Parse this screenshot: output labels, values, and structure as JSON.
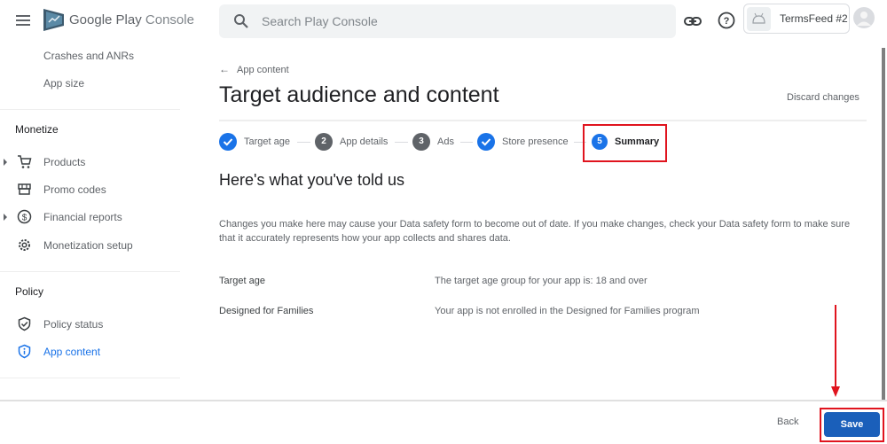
{
  "header": {
    "brand_primary": "Google Play",
    "brand_secondary": "Console",
    "search_placeholder": "Search Play Console",
    "search_value": "",
    "app_name": "TermsFeed #2",
    "icons": [
      "menu-icon",
      "play-console-logo-icon",
      "search-icon",
      "link-icon",
      "help-icon",
      "android-icon",
      "avatar-icon"
    ]
  },
  "sidebar": {
    "top_items": [
      {
        "label": "Crashes and ANRs"
      },
      {
        "label": "App size"
      }
    ],
    "monetize": {
      "heading": "Monetize",
      "items": [
        {
          "label": "Products",
          "icon": "cart-icon",
          "expandable": true
        },
        {
          "label": "Promo codes",
          "icon": "store-icon",
          "expandable": false
        },
        {
          "label": "Financial reports",
          "icon": "dollar-icon",
          "expandable": true
        },
        {
          "label": "Monetization setup",
          "icon": "gear-icon",
          "expandable": false
        }
      ]
    },
    "policy": {
      "heading": "Policy",
      "items": [
        {
          "label": "Policy status",
          "icon": "shield-check-icon",
          "active": false
        },
        {
          "label": "App content",
          "icon": "shield-info-icon",
          "active": true
        }
      ]
    }
  },
  "main": {
    "back_link": "App content",
    "page_title": "Target audience and content",
    "discard_label": "Discard changes",
    "steps": [
      {
        "label": "Target age",
        "state": "done",
        "number": "1"
      },
      {
        "label": "App details",
        "state": "todo",
        "number": "2"
      },
      {
        "label": "Ads",
        "state": "todo",
        "number": "3"
      },
      {
        "label": "Store presence",
        "state": "done",
        "number": "4"
      },
      {
        "label": "Summary",
        "state": "current",
        "number": "5"
      }
    ],
    "section_title": "Here's what you've told us",
    "note": "Changes you make here may cause your Data safety form to become out of date. If you make changes, check your Data safety form to make sure that it accurately represents how your app collects and shares data.",
    "summary_rows": [
      {
        "label": "Target age",
        "value": "The target age group for your app is: 18 and over"
      },
      {
        "label": "Designed for Families",
        "value": "Your app is not enrolled in the Designed for Families program"
      }
    ]
  },
  "footer": {
    "back_label": "Back",
    "save_label": "Save"
  },
  "colors": {
    "accent": "#1a73e8",
    "save_button": "#1a5fba",
    "annotation": "#e0141e"
  }
}
